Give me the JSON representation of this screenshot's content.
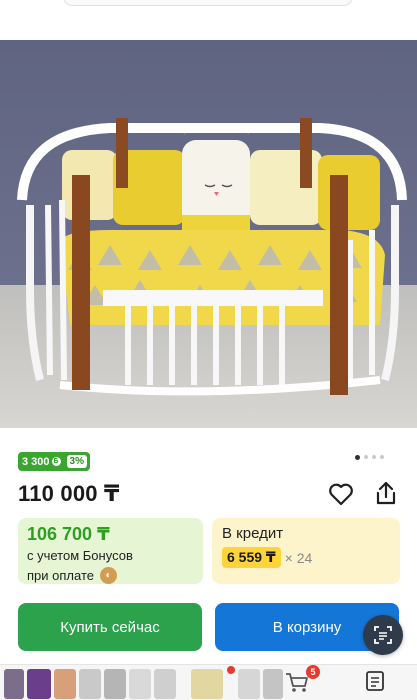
{
  "product": {
    "cashback_amount": "3 300",
    "cashback_currency_icon": "Б",
    "cashback_percent": "3%",
    "price": "110 000 ₸",
    "gallery_total": 4,
    "gallery_active": 1
  },
  "bonus": {
    "price": "106 700 ₸",
    "line1": "с учетом Бонусов",
    "line2": "при оплате"
  },
  "credit": {
    "title": "В кредит",
    "monthly": "6 559 ₸",
    "term": "× 24"
  },
  "actions": {
    "buy_label": "Купить сейчас",
    "cart_label": "В корзину"
  },
  "bottom_bar": {
    "cart_count": "5"
  },
  "colors": {
    "green": "#2da24d",
    "blue": "#1477d8",
    "bonus_bg": "#e6f5d4",
    "credit_bg": "#fdf4cc",
    "credit_highlight": "#ffd43b"
  }
}
